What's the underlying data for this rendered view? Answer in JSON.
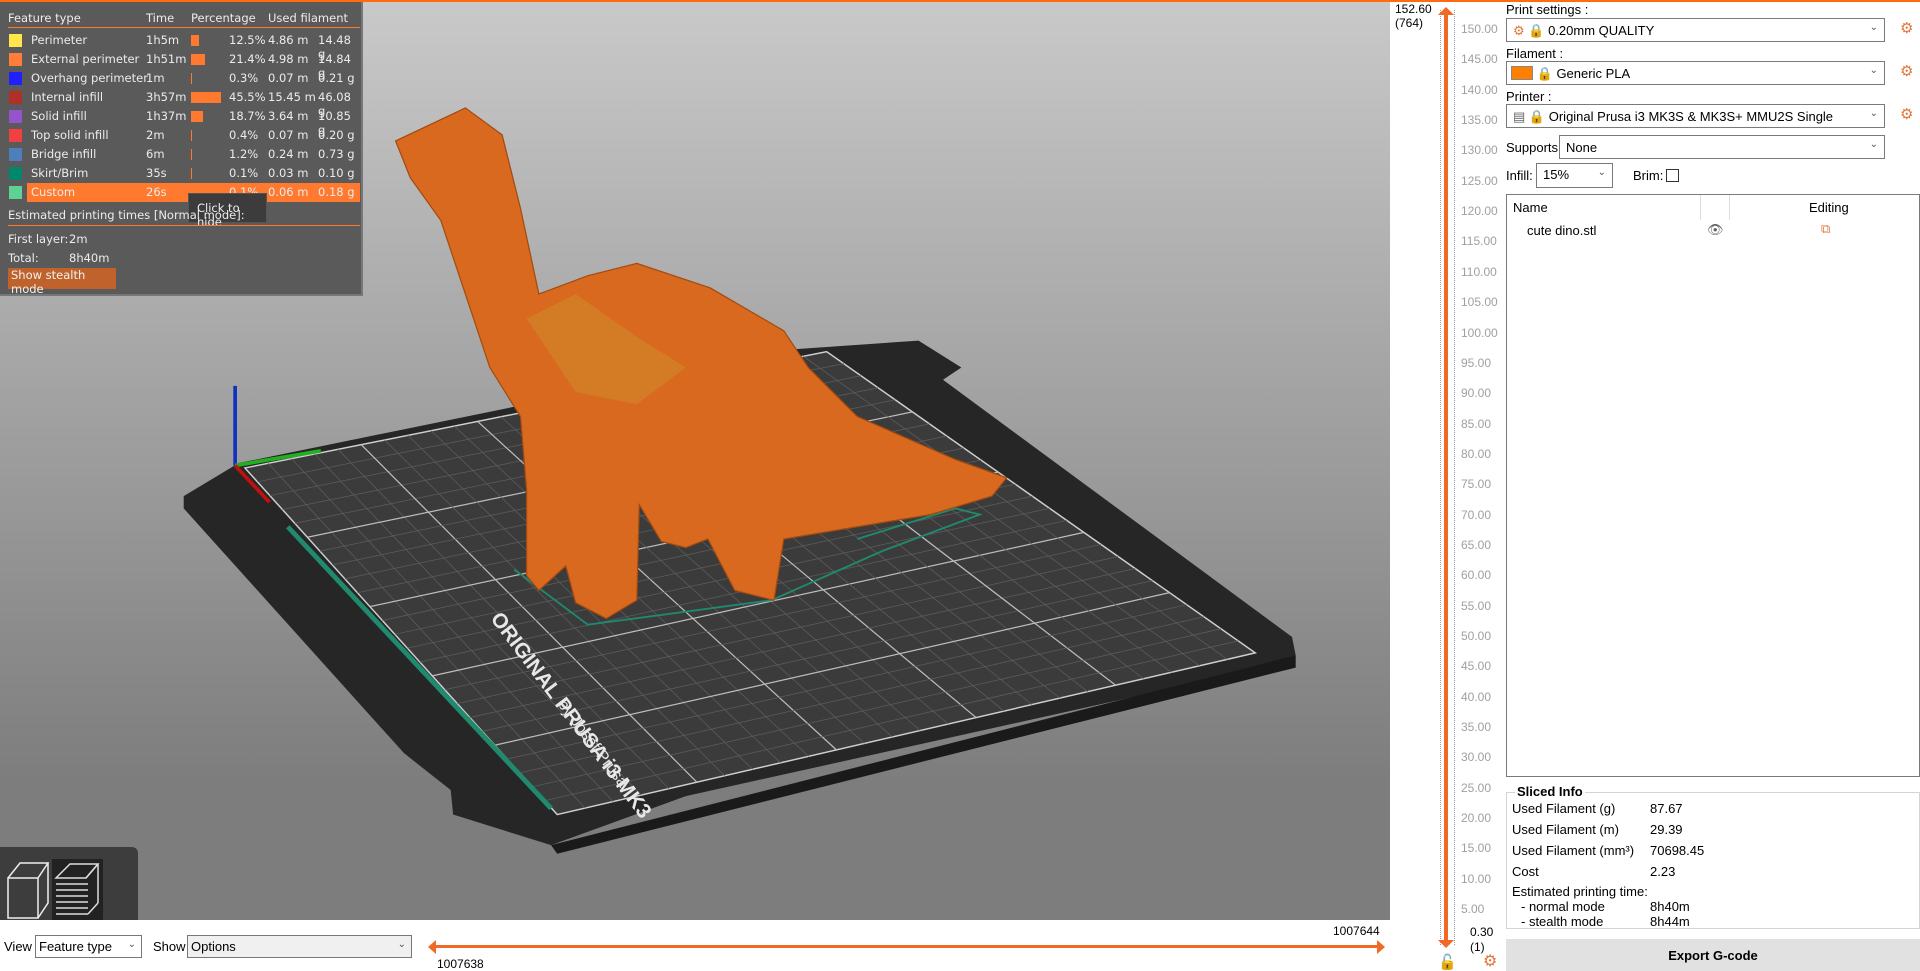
{
  "legend": {
    "headers": [
      "Feature type",
      "Time",
      "Percentage",
      "Used filament"
    ],
    "rows": [
      {
        "name": "Perimeter",
        "color": "#ffe64d",
        "time": "1h5m",
        "pct": 12.5,
        "pct_label": "12.5%",
        "length": "4.86 m",
        "weight": "14.48 g"
      },
      {
        "name": "External perimeter",
        "color": "#ff7d38",
        "time": "1h51m",
        "pct": 21.4,
        "pct_label": "21.4%",
        "length": "4.98 m",
        "weight": "14.84 g"
      },
      {
        "name": "Overhang perimeter",
        "color": "#1f1fff",
        "time": "1m",
        "pct": 0.3,
        "pct_label": "0.3%",
        "length": "0.07 m",
        "weight": "0.21 g"
      },
      {
        "name": "Internal infill",
        "color": "#b03029",
        "time": "3h57m",
        "pct": 45.5,
        "pct_label": "45.5%",
        "length": "15.45 m",
        "weight": "46.08 g"
      },
      {
        "name": "Solid infill",
        "color": "#9654cc",
        "time": "1h37m",
        "pct": 18.7,
        "pct_label": "18.7%",
        "length": "3.64 m",
        "weight": "10.85 g"
      },
      {
        "name": "Top solid infill",
        "color": "#f04040",
        "time": "2m",
        "pct": 0.4,
        "pct_label": "0.4%",
        "length": "0.07 m",
        "weight": "0.20 g"
      },
      {
        "name": "Bridge infill",
        "color": "#4d80ba",
        "time": "6m",
        "pct": 1.2,
        "pct_label": "1.2%",
        "length": "0.24 m",
        "weight": "0.73 g"
      },
      {
        "name": "Skirt/Brim",
        "color": "#00876e",
        "time": "35s",
        "pct": 0.1,
        "pct_label": "0.1%",
        "length": "0.03 m",
        "weight": "0.10 g"
      },
      {
        "name": "Custom",
        "color": "#5ed194",
        "time": "26s",
        "pct": 0.1,
        "pct_label": "0.1%",
        "length": "0.06 m",
        "weight": "0.18 g",
        "highlighted": true
      }
    ],
    "tooltip": "Click to hide",
    "estimated_label": "Estimated printing times [Normal mode]:",
    "first_layer_label": "First layer:",
    "first_layer": "2m",
    "total_label": "Total:",
    "total": "8h40m",
    "stealth_button": "Show stealth mode"
  },
  "scene": {
    "bed_text_1": "ORIGINAL PRUSA i3 MK3",
    "bed_text_2": "by Josef Prusa",
    "model_color": "#d9691f"
  },
  "vslider": {
    "top_value": "152.60",
    "top_layer": "(764)",
    "bottom_value": "0.30",
    "bottom_layer": "(1)",
    "ticks": [
      "150.00",
      "145.00",
      "140.00",
      "135.00",
      "130.00",
      "125.00",
      "120.00",
      "115.00",
      "110.00",
      "105.00",
      "100.00",
      "95.00",
      "90.00",
      "85.00",
      "80.00",
      "75.00",
      "70.00",
      "65.00",
      "60.00",
      "55.00",
      "50.00",
      "45.00",
      "40.00",
      "35.00",
      "30.00",
      "25.00",
      "20.00",
      "15.00",
      "10.00",
      "5.00"
    ]
  },
  "hslider": {
    "left_value": "1007638",
    "right_value": "1007644"
  },
  "bottom": {
    "view_label": "View",
    "view_value": "Feature type",
    "show_label": "Show",
    "show_value": "Options"
  },
  "right": {
    "print_settings_label": "Print settings :",
    "print_settings": "0.20mm QUALITY",
    "filament_label": "Filament :",
    "filament": "Generic PLA",
    "filament_color": "#ff8000",
    "printer_label": "Printer :",
    "printer": "Original Prusa i3 MK3S & MK3S+ MMU2S Single",
    "supports_label": "Supports:",
    "supports": "None",
    "infill_label": "Infill:",
    "infill": "15%",
    "brim_label": "Brim:",
    "list_headers": {
      "name": "Name",
      "editing": "Editing"
    },
    "objects": [
      {
        "name": "cute dino.stl"
      }
    ],
    "sliced_info": {
      "title": "Sliced Info",
      "rows": [
        {
          "label": "Used Filament (g)",
          "value": "87.67"
        },
        {
          "label": "Used Filament (m)",
          "value": "29.39"
        },
        {
          "label": "Used Filament (mm³)",
          "value": "70698.45"
        },
        {
          "label": "Cost",
          "value": "2.23"
        }
      ],
      "time_label": "Estimated printing time:",
      "normal_label": "- normal mode",
      "normal": "8h40m",
      "stealth_label": "- stealth mode",
      "stealth": "8h44m"
    },
    "export_button": "Export G-code"
  },
  "accent": "#ff6a13"
}
